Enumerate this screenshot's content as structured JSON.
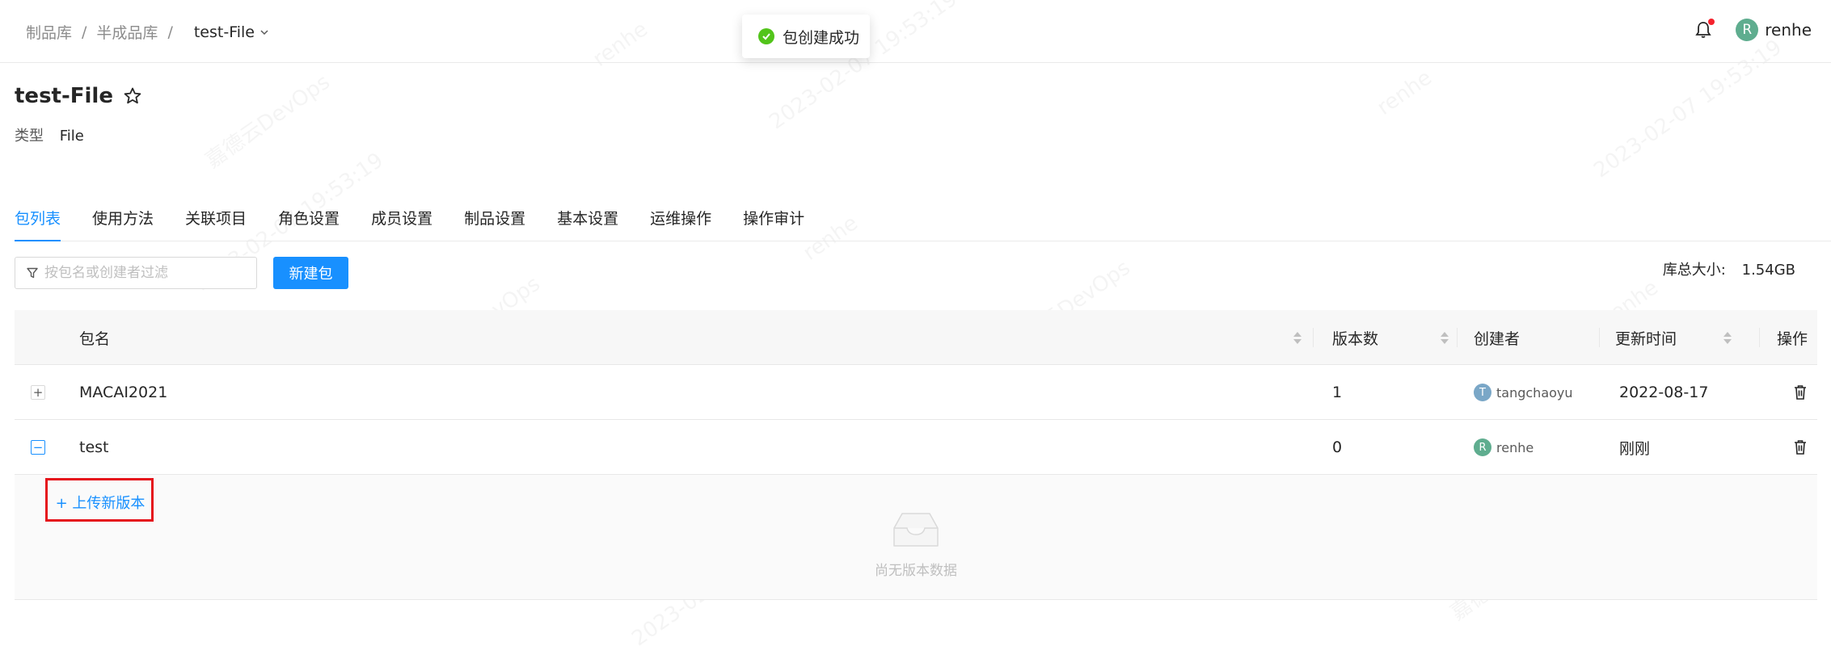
{
  "breadcrumb": {
    "items": [
      "制品库",
      "半成品库"
    ],
    "separator": "/",
    "current": "test-File"
  },
  "toast": {
    "message": "包创建成功"
  },
  "user": {
    "avatar_letter": "R",
    "name": "renhe"
  },
  "repo": {
    "title": "test-File",
    "type_label": "类型",
    "type_value": "File"
  },
  "tabs": [
    {
      "label": "包列表",
      "active": true
    },
    {
      "label": "使用方法"
    },
    {
      "label": "关联项目"
    },
    {
      "label": "角色设置"
    },
    {
      "label": "成员设置"
    },
    {
      "label": "制品设置"
    },
    {
      "label": "基本设置"
    },
    {
      "label": "运维操作"
    },
    {
      "label": "操作审计"
    }
  ],
  "toolbar": {
    "filter_placeholder": "按包名或创建者过滤",
    "new_button": "新建包",
    "size_label": "库总大小:",
    "size_value": "1.54GB"
  },
  "table": {
    "headers": {
      "name": "包名",
      "versions": "版本数",
      "creator": "创建者",
      "updated": "更新时间",
      "actions": "操作"
    },
    "rows": [
      {
        "expander": "+",
        "name": "MACAI2021",
        "versions": "1",
        "creator_letter": "T",
        "creator": "tangchaoyu",
        "updated": "2022-08-17"
      },
      {
        "expander": "−",
        "name": "test",
        "versions": "0",
        "creator_letter": "R",
        "creator": "renhe",
        "updated": "刚刚"
      }
    ],
    "expanded": {
      "upload_link": "+ 上传新版本",
      "empty_text": "尚无版本数据"
    }
  },
  "watermark": {
    "texts": [
      "renhe",
      "2023-02-07 19:53:19",
      "嘉德云DevOps"
    ]
  },
  "colors": {
    "primary": "#1890ff",
    "success": "#52c41a",
    "notification_dot": "#f5222d",
    "highlight_box": "#e5121b",
    "avatar_renhe": "#5fad8f",
    "avatar_tangchaoyu": "#7aa7c7"
  }
}
